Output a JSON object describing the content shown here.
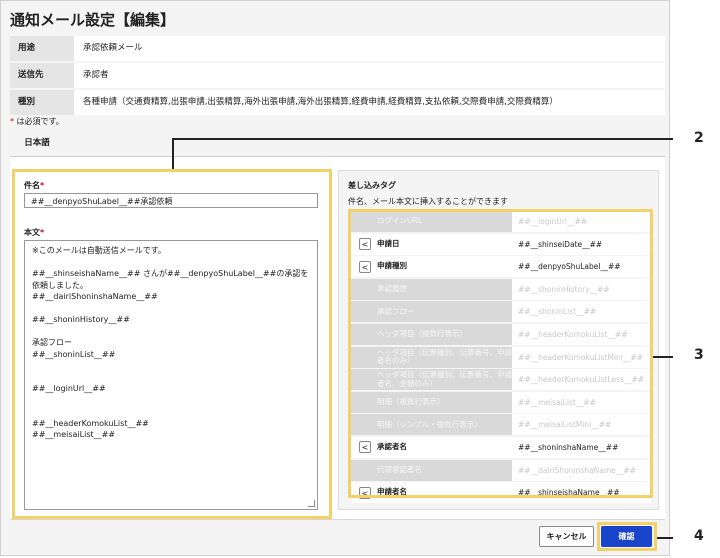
{
  "page_title": "通知メール設定【編集】",
  "info": [
    {
      "key": "用途",
      "value": "承認依頼メール"
    },
    {
      "key": "送信先",
      "value": "承認者"
    },
    {
      "key": "種別",
      "value": "各種申請（交通費精算,出張申請,出張精算,海外出張申請,海外出張精算,経費申請,経費精算,支払依頼,交際費申請,交際費精算）"
    }
  ],
  "required_note": {
    "star": "*",
    "text": " は必須です。"
  },
  "tab": {
    "label": "日本語"
  },
  "subject": {
    "label": "件名",
    "star": "*",
    "value": "##__denpyoShuLabel__##承認依頼"
  },
  "body": {
    "label": "本文",
    "star": "*",
    "lines": [
      "※このメールは自動送信メールです。",
      "",
      "##__shinseishaName__## さんが##__denpyoShuLabel__##の承認を依頼しました。",
      "##__dairiShoninshaName__##",
      "",
      "##__shoninHistory__##",
      "",
      "承認フロー",
      "##__shoninList__##",
      "",
      "",
      "##__loginUrl__##",
      "",
      "",
      "##__headerKomokuList__##",
      "##__meisaiList__##"
    ]
  },
  "merge_tags": {
    "title": "差し込みタグ",
    "description": "件名、メール本文に挿入することができます",
    "button_glyph": "<",
    "items": [
      {
        "label": "ログインURL",
        "code": "##__loginUrl__##",
        "enabled": false
      },
      {
        "label": "申請日",
        "code": "##__shinseiDate__##",
        "enabled": true
      },
      {
        "label": "申請種別",
        "code": "##__denpyoShuLabel__##",
        "enabled": true
      },
      {
        "label": "承認履歴",
        "code": "##__shoninHistory__##",
        "enabled": false
      },
      {
        "label": "承認フロー",
        "code": "##__shoninList__##",
        "enabled": false
      },
      {
        "label": "ヘッダ項目（複数行表示）",
        "code": "##__headerKomokuList__##",
        "enabled": false
      },
      {
        "label": "ヘッダ項目（伝票種別、伝票番号、申請者名のみ）",
        "code": "##__headerKomokuListMini__##",
        "enabled": false
      },
      {
        "label": "ヘッダ項目（伝票種別、伝票番号、申請者名、金額のみ）",
        "code": "##__headerKomokuListLess__##",
        "enabled": false
      },
      {
        "label": "明細（複数行表示）",
        "code": "##__meisaiList__##",
        "enabled": false
      },
      {
        "label": "明細（シンプル・複数行表示）",
        "code": "##__meisaiListMini__##",
        "enabled": false
      },
      {
        "label": "承認者名",
        "code": "##__shoninshaName__##",
        "enabled": true
      },
      {
        "label": "代理承認者名",
        "code": "##__dairiShoninshaName__##",
        "enabled": false
      },
      {
        "label": "申請者名",
        "code": "##__shinseishaName__##",
        "enabled": true
      }
    ]
  },
  "footer": {
    "cancel_label": "キャンセル",
    "ok_label": "確認"
  },
  "callouts": [
    "2",
    "3",
    "4"
  ],
  "colors": {
    "highlight": "#f2d16b",
    "primary": "#1a44c9",
    "required": "#d0021b"
  }
}
